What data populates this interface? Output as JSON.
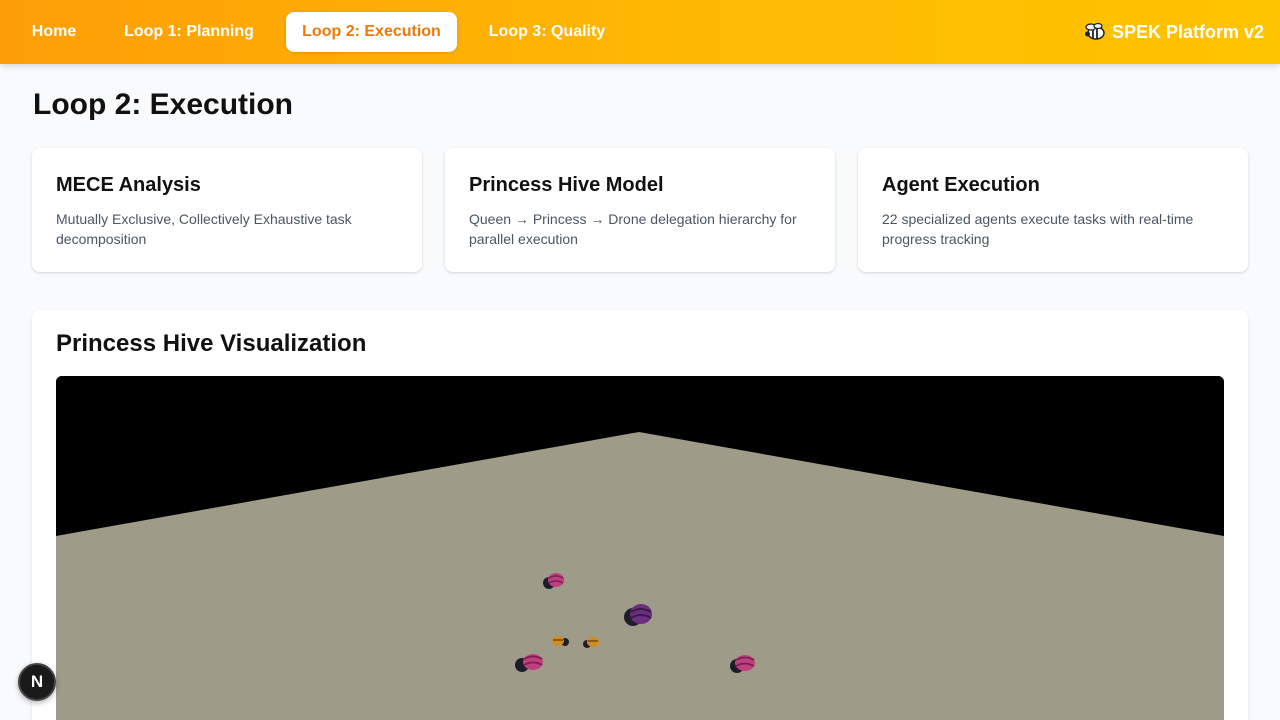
{
  "nav": {
    "items": [
      {
        "label": "Home",
        "active": false
      },
      {
        "label": "Loop 1: Planning",
        "active": false
      },
      {
        "label": "Loop 2: Execution",
        "active": true
      },
      {
        "label": "Loop 3: Quality",
        "active": false
      }
    ],
    "brand_icon": "bee-icon",
    "brand": "SPEK Platform v2",
    "accent_color": "#ea7a0c"
  },
  "page": {
    "title": "Loop 2: Execution"
  },
  "cards": [
    {
      "title": "MECE Analysis",
      "description": "Mutually Exclusive, Collectively Exhaustive task decomposition"
    },
    {
      "title": "Princess Hive Model",
      "description": "Queen → Princess → Drone delegation hierarchy for parallel execution"
    },
    {
      "title": "Agent Execution",
      "description": "22 specialized agents execute tasks with real-time progress tracking"
    }
  ],
  "visualization": {
    "title": "Princess Hive Visualization",
    "floor_color": "#9e9b88",
    "agents": [
      {
        "role": "queen",
        "color": "#6b2f82"
      },
      {
        "role": "princess",
        "color": "#c0407f"
      },
      {
        "role": "princess",
        "color": "#c0407f"
      },
      {
        "role": "princess",
        "color": "#c0407f"
      },
      {
        "role": "drone",
        "color": "#d18b1e"
      },
      {
        "role": "drone",
        "color": "#d18b1e"
      }
    ]
  },
  "badge": {
    "label": "N",
    "icon": "nextjs-icon"
  }
}
